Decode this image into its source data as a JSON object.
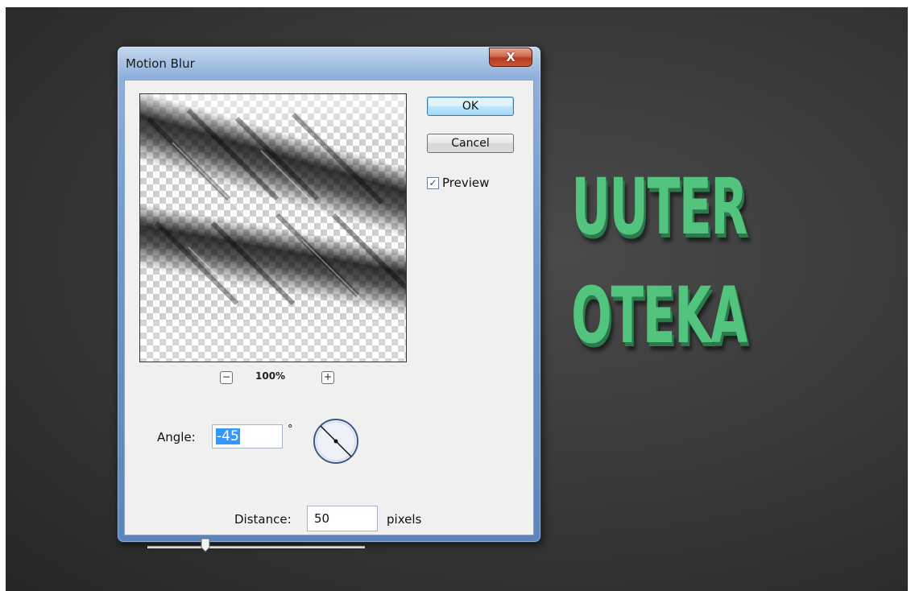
{
  "background": {
    "line1": "UUTER",
    "line2": "OTEKA",
    "text_color": "#52c47e"
  },
  "dialog": {
    "title": "Motion Blur",
    "close_label": "X",
    "ok_label": "OK",
    "cancel_label": "Cancel",
    "preview_label": "Preview",
    "preview_checked": true,
    "zoom": {
      "minus": "−",
      "plus": "+",
      "level": "100%"
    },
    "angle": {
      "label": "Angle:",
      "value": "-45",
      "unit": "°"
    },
    "distance": {
      "label": "Distance:",
      "value": "50",
      "unit": "pixels"
    }
  }
}
